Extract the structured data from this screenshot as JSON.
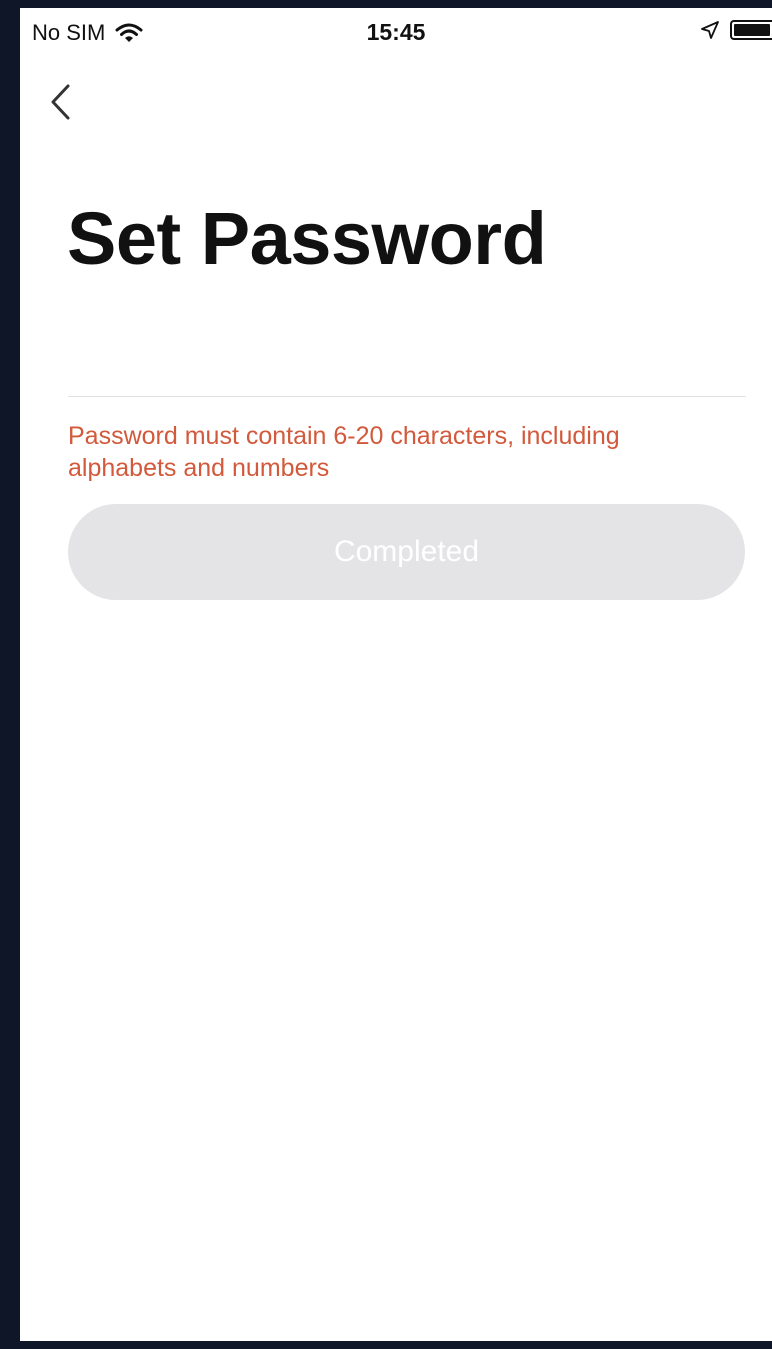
{
  "status_bar": {
    "carrier": "No SIM",
    "time": "15:45",
    "icons": [
      "wifi-icon",
      "location-arrow-icon",
      "battery-icon"
    ]
  },
  "nav": {
    "back_icon": "chevron-left-icon"
  },
  "page": {
    "title": "Set Password"
  },
  "form": {
    "password_value": "",
    "password_placeholder": "",
    "hint": "Password must contain 6-20 characters, including alphabets and numbers",
    "submit_label": "Completed",
    "submit_enabled": false
  },
  "colors": {
    "hint": "#d2593b",
    "button_disabled_bg": "#e4e4e6",
    "button_text": "#ffffff",
    "frame_bg": "#0e1628"
  }
}
